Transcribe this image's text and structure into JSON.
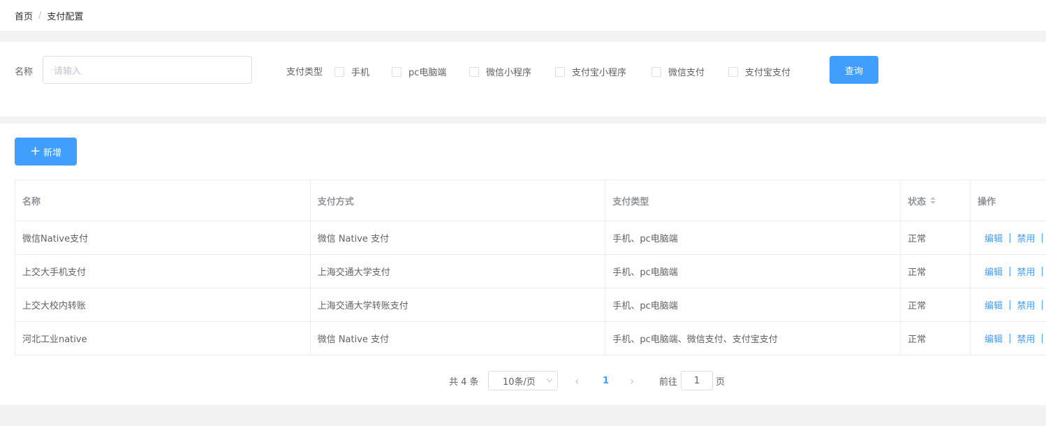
{
  "breadcrumb": {
    "home": "首页",
    "separator": "/",
    "current": "支付配置"
  },
  "search": {
    "name_label": "名称",
    "name_placeholder": "请输入",
    "type_label": "支付类型",
    "type_options": [
      "手机",
      "pc电脑端",
      "微信小程序",
      "支付宝小程序",
      "微信支付",
      "支付宝支付"
    ],
    "query_button": "查询"
  },
  "toolbar": {
    "add_icon": "plus-icon",
    "add_label": "新增"
  },
  "table": {
    "headers": [
      "名称",
      "支付方式",
      "支付类型",
      "状态",
      "操作"
    ],
    "rows": [
      {
        "name": "微信Native支付",
        "method": "微信 Native 支付",
        "types": "手机、pc电脑端",
        "status": "正常"
      },
      {
        "name": "上交大手机支付",
        "method": "上海交通大学支付",
        "types": "手机、pc电脑端",
        "status": "正常"
      },
      {
        "name": "上交大校内转账",
        "method": "上海交通大学转账支付",
        "types": "手机、pc电脑端",
        "status": "正常"
      },
      {
        "name": "河北工业native",
        "method": "微信 Native 支付",
        "types": "手机、pc电脑端、微信支付、支付宝支付",
        "status": "正常"
      }
    ],
    "actions": {
      "edit": "编辑",
      "disable": "禁用",
      "separator": "|"
    }
  },
  "pagination": {
    "total_text": "共 4 条",
    "page_size": "10条/页",
    "prev_icon": "chevron-left-icon",
    "current_page": "1",
    "next_icon": "chevron-right-icon",
    "goto_label": "前往",
    "goto_value": "1",
    "page_suffix": "页"
  },
  "colors": {
    "primary": "#409eff",
    "border": "#dcdfe6",
    "background": "#f0f2f5"
  }
}
